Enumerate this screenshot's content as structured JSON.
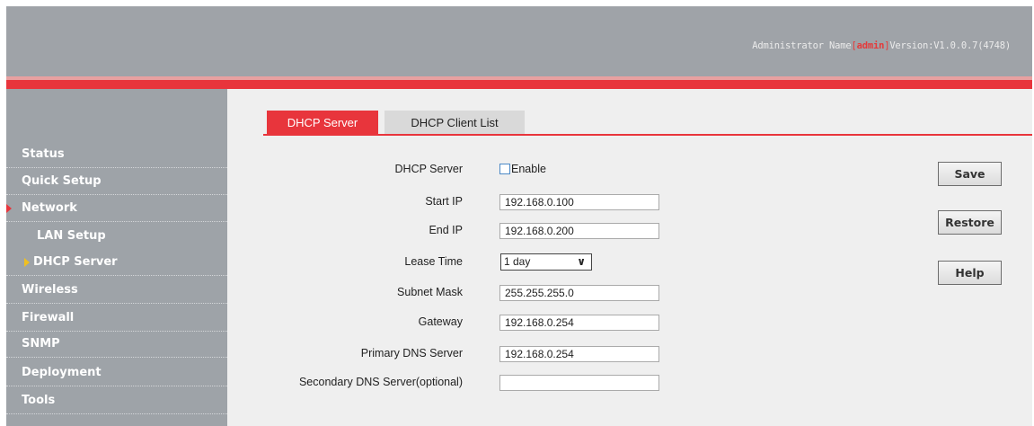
{
  "header": {
    "info_prefix": "Administrator Name",
    "bracket_open": "[",
    "admin_name": "admin",
    "bracket_close": "]",
    "version": "Version:V1.0.0.7(4748)"
  },
  "sidebar": {
    "items": [
      {
        "label": "Status"
      },
      {
        "label": "Quick Setup"
      },
      {
        "label": "Network"
      },
      {
        "label": "LAN Setup"
      },
      {
        "label": "DHCP Server"
      },
      {
        "label": "Wireless"
      },
      {
        "label": "Firewall"
      },
      {
        "label": "SNMP"
      },
      {
        "label": "Deployment"
      },
      {
        "label": "Tools"
      }
    ]
  },
  "tabs": [
    {
      "label": "DHCP Server",
      "active": true
    },
    {
      "label": "DHCP Client List",
      "active": false
    }
  ],
  "form": {
    "dhcp_server_label": "DHCP Server",
    "enable_label": "Enable",
    "enable_checked": false,
    "start_ip_label": "Start IP",
    "start_ip": "192.168.0.100",
    "end_ip_label": "End IP",
    "end_ip": "192.168.0.200",
    "lease_time_label": "Lease Time",
    "lease_time": "1 day",
    "subnet_mask_label": "Subnet Mask",
    "subnet_mask": "255.255.255.0",
    "gateway_label": "Gateway",
    "gateway": "192.168.0.254",
    "primary_dns_label": "Primary DNS Server",
    "primary_dns": "192.168.0.254",
    "secondary_dns_label": "Secondary DNS Server(optional)",
    "secondary_dns": ""
  },
  "buttons": {
    "save": "Save",
    "restore": "Restore",
    "help": "Help"
  },
  "colors": {
    "accent": "#e8353c",
    "sidebar": "#9ea3a8",
    "header": "#9fa3a8",
    "active_arrow": "#f0c020"
  }
}
